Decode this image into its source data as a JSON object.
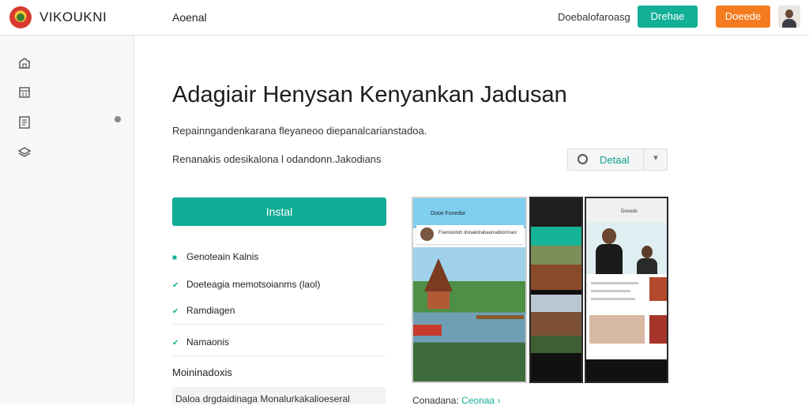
{
  "header": {
    "brand": "VIKOUKNI",
    "nav_item": "Aoenal",
    "link": "Doebalofaroasg",
    "teal_button": "Drehae",
    "orange_button": "Doeede",
    "colors": {
      "teal": "#12b097",
      "orange": "#f47b20"
    }
  },
  "sidebar": {
    "icons": [
      "store-icon",
      "calendar-icon",
      "document-icon",
      "layers-icon"
    ]
  },
  "main": {
    "title": "Adagiair Henysan Kenyankan Jadusan",
    "subtitle": "Repainngandenkarana fleyaneoo diepanalcarianstadoa.",
    "meta": "Renanakis odesikalona l odandonn.Jakodians",
    "detail_button": "Detaal",
    "install_button": "Instal",
    "features": [
      "Genoteain Kalnis",
      "Doeteagia memotsoianms (laol)",
      "Ramdiagen",
      "Namaonis"
    ],
    "section_label": "Moininadoxis",
    "footer_text": "Daloa drgdaidinaga Monalurkakalioeseral",
    "screenshots": {
      "phone1_header": "Dooe Fsnedor",
      "phone1_card": "Foenoodoh donakdrabaoroabiomraor",
      "phone3_header": "Dooods"
    },
    "caption": "Conadana:",
    "caption_link": "Ceonaa"
  }
}
